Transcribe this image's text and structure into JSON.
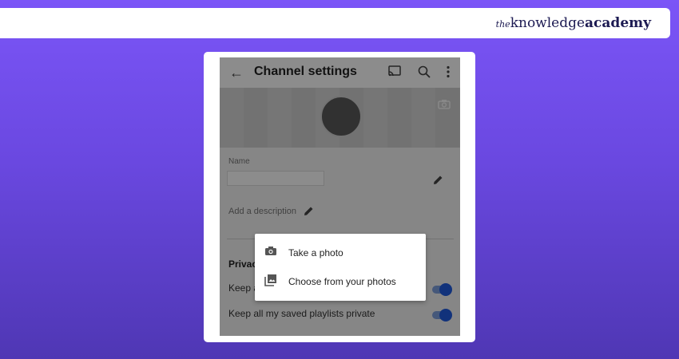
{
  "brand": {
    "prefix": "the",
    "word1": "knowledge",
    "word2": "academy"
  },
  "app": {
    "title": "Channel settings",
    "icons": [
      "back-arrow-icon",
      "cast-icon",
      "search-icon",
      "more-vert-icon",
      "camera-icon",
      "edit-pencil-icon"
    ]
  },
  "form": {
    "name_label": "Name",
    "name_value": "",
    "description_placeholder": "Add a description"
  },
  "privacy": {
    "heading_visible": "Privac",
    "row1_visible": "Keep a",
    "row2_label": "Keep all my saved playlists private",
    "row1_on": true,
    "row2_on": true
  },
  "popup": {
    "options": [
      {
        "label": "Take a photo",
        "icon": "camera-icon"
      },
      {
        "label": "Choose from your photos",
        "icon": "photo-library-icon"
      }
    ]
  },
  "colors": {
    "background_top": "#7b55f7",
    "background_bottom": "#4f37b4",
    "toggle_on": "#1f5be0",
    "brand_text": "#1c1a52"
  }
}
